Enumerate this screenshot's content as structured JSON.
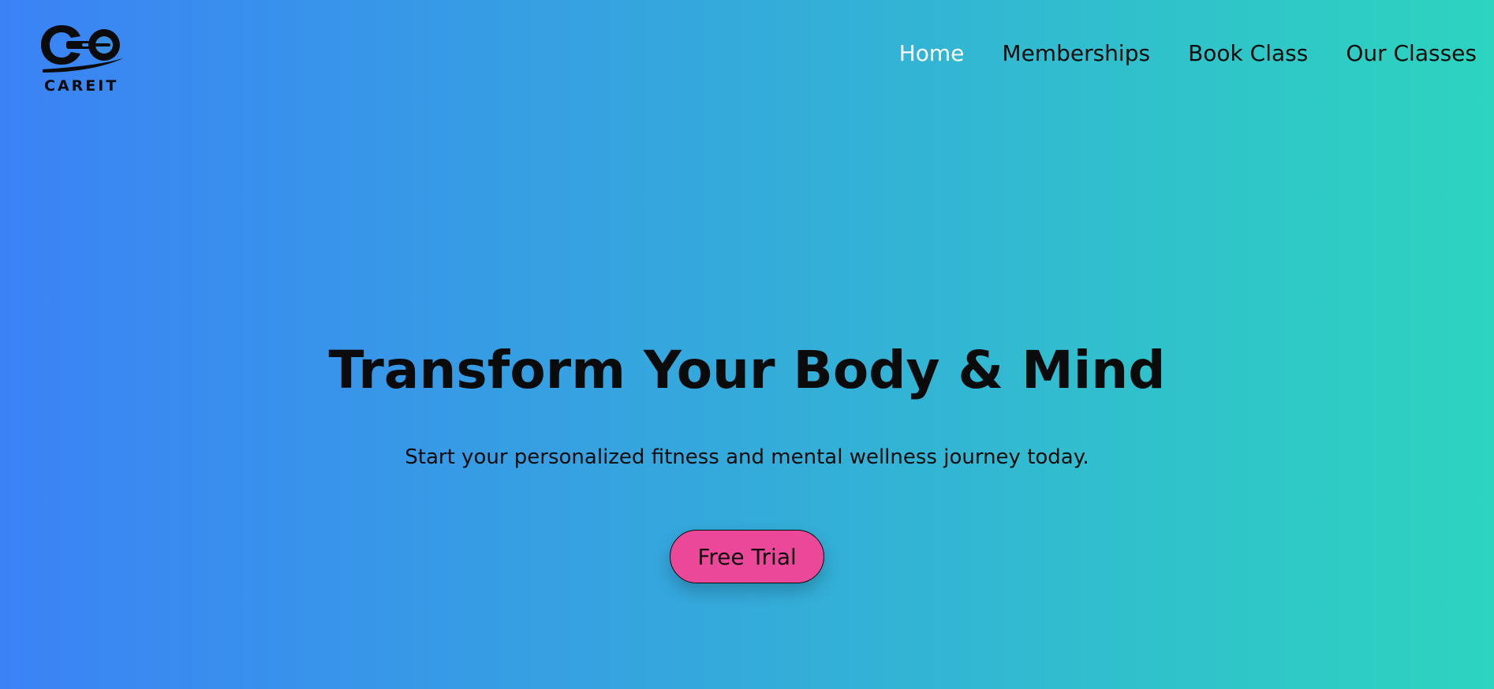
{
  "brand": {
    "name": "CAREIT",
    "logo_icon": "dumbbell-logo-icon"
  },
  "nav": {
    "items": [
      {
        "label": "Home",
        "active": true
      },
      {
        "label": "Memberships",
        "active": false
      },
      {
        "label": "Book Class",
        "active": false
      },
      {
        "label": "Our Classes",
        "active": false
      }
    ]
  },
  "hero": {
    "title": "Transform Your Body & Mind",
    "subtitle": "Start your personalized fitness and mental wellness journey today.",
    "cta_label": "Free Trial"
  },
  "colors": {
    "gradient_start": "#3b82f6",
    "gradient_end": "#2dd4bf",
    "cta_background": "#ec4899",
    "nav_active": "#ffffff",
    "text": "#0b0b0b"
  }
}
